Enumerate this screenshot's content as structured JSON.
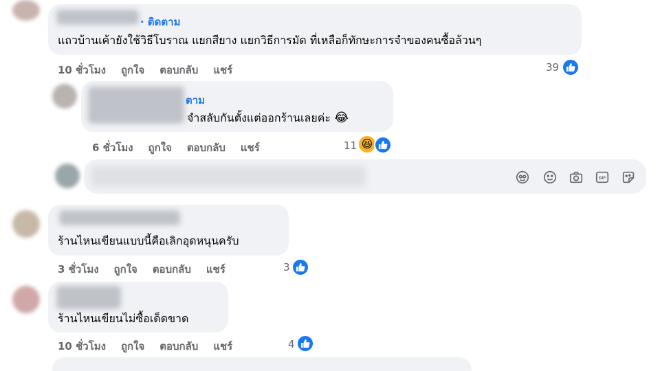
{
  "comments": [
    {
      "follow_label": "· ติดตาม",
      "text": "แถวบ้านเค้ายังใช้วิธีโบราณ แยกสียาง แยกวิธีการมัด ที่เหลือก็ทักษะการจำของคนซื้อล้วนๆ",
      "time": "10 ชั่วโมง",
      "like": "ถูกใจ",
      "reply": "ตอบกลับ",
      "share": "แชร์",
      "reactions": "39"
    },
    {
      "follow_label": "ตาม",
      "text": "จำสลับกันตั้งแต่ออกร้านเลยค่ะ",
      "emoji": "😂",
      "time": "6 ชั่วโมง",
      "like": "ถูกใจ",
      "reply": "ตอบกลับ",
      "share": "แชร์",
      "reactions": "11"
    },
    {
      "text": "ร้านไหนเขียนแบบนี้คือเลิกอุดหนุนครับ",
      "time": "3 ชั่วโมง",
      "like": "ถูกใจ",
      "reply": "ตอบกลับ",
      "share": "แชร์",
      "reactions": "3"
    },
    {
      "text": "ร้านไหนเขียนไม่ซื้อเด็ดขาด",
      "time": "10 ชั่วโมง",
      "like": "ถูกใจ",
      "reply": "ตอบกลับ",
      "share": "แชร์",
      "reactions": "4"
    }
  ],
  "composer": {
    "icons": [
      "avatar-sticker-icon",
      "emoji-icon",
      "camera-icon",
      "gif-icon",
      "sticker-icon"
    ]
  },
  "colors": {
    "accent": "#1877f2",
    "bubble": "#f0f2f5",
    "meta_text": "#65676b"
  }
}
